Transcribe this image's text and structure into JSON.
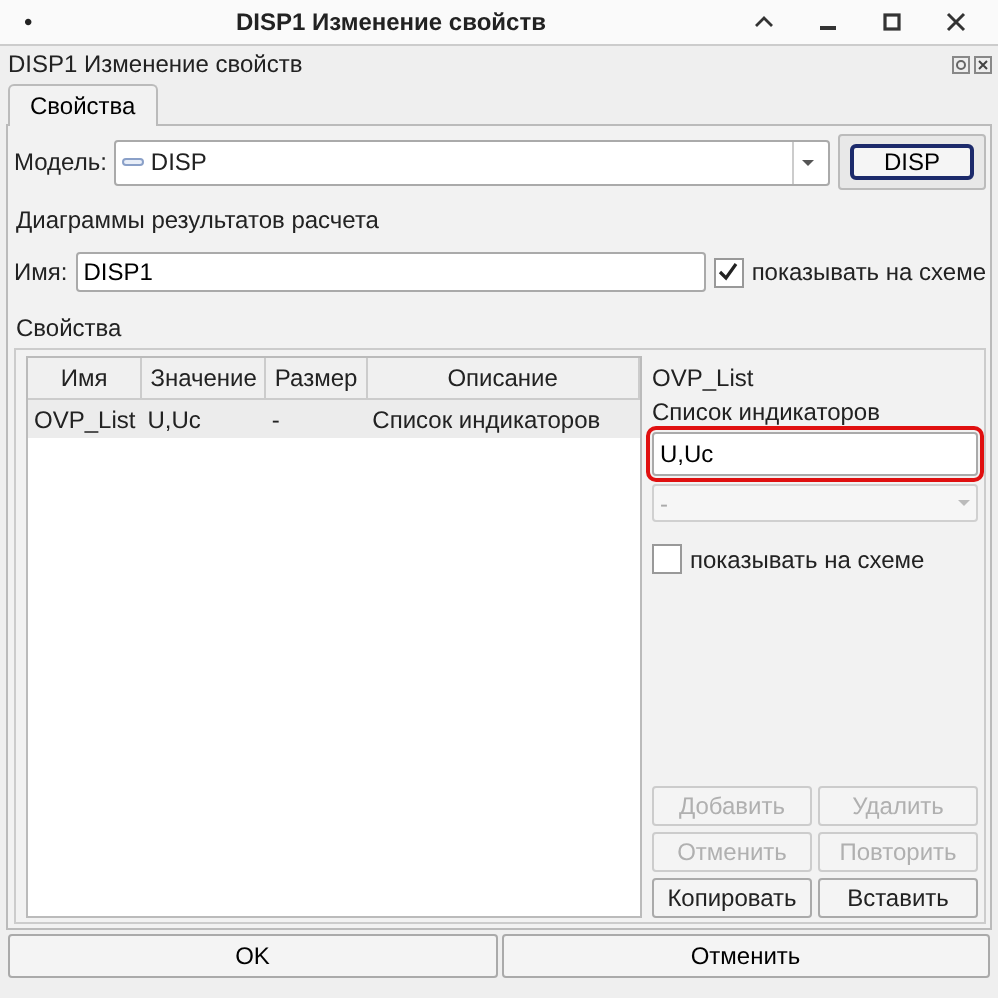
{
  "window": {
    "menu_glyph": "•",
    "title": "DISP1 Изменение свойств"
  },
  "dialog": {
    "title": "DISP1 Изменение свойств"
  },
  "tabs": [
    {
      "label": "Свойства",
      "selected": true
    }
  ],
  "model": {
    "label": "Модель:",
    "value": "DISP",
    "button": "DISP"
  },
  "diagrams_heading": "Диаграммы результатов расчета",
  "name": {
    "label": "Имя:",
    "value": "DISP1",
    "show_on_scheme": {
      "label": "показывать на схеме",
      "checked": true
    }
  },
  "properties": {
    "title": "Свойства",
    "table": {
      "columns": [
        "Имя",
        "Значение",
        "Размер",
        "Описание"
      ],
      "rows": [
        {
          "cells": [
            "OVP_List",
            "U,Uc",
            "-",
            "Список индикаторов"
          ],
          "selected": true
        }
      ]
    },
    "side_panel": {
      "name": "OVP_List",
      "description": "Список индикаторов",
      "value": "U,Uc",
      "highlighted": true,
      "unit": {
        "value": "-",
        "disabled": true
      },
      "show_on_scheme": {
        "label": "показывать на схеме",
        "checked": false
      },
      "buttons": [
        {
          "label": "Добавить",
          "disabled": true
        },
        {
          "label": "Удалить",
          "disabled": true
        },
        {
          "label": "Отменить",
          "disabled": true
        },
        {
          "label": "Повторить",
          "disabled": true
        },
        {
          "label": "Копировать",
          "disabled": false
        },
        {
          "label": "Вставить",
          "disabled": false
        }
      ]
    }
  },
  "buttons": [
    "OK",
    "Отменить"
  ]
}
